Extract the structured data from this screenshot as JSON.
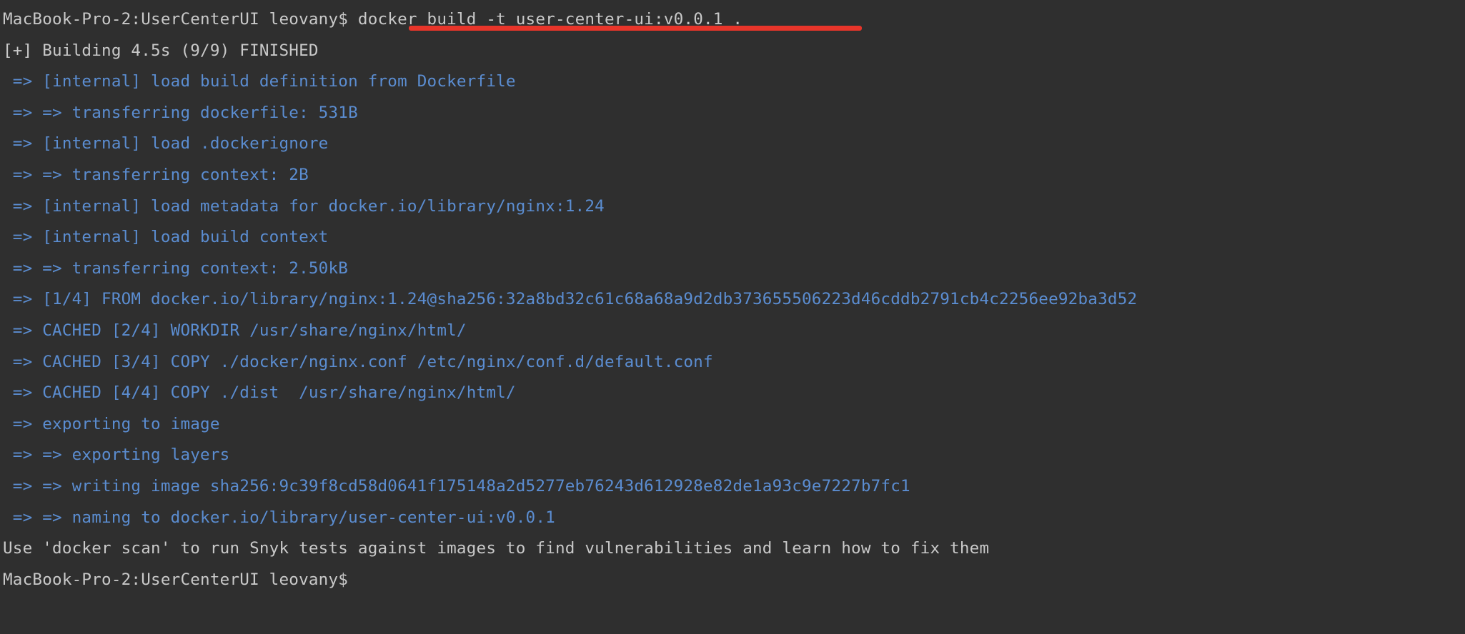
{
  "window": {
    "app": "Terminal",
    "background_color": "#2f2f2f",
    "default_text_color": "#c9c9c9",
    "build_output_color": "#5b8dd1",
    "annotation_color": "#e8352a"
  },
  "session": {
    "prompt": "MacBook-Pro-2:UserCenterUI leovany$",
    "hostname": "MacBook-Pro-2",
    "cwd_name": "UserCenterUI",
    "user": "leovany"
  },
  "command": {
    "prompt": "MacBook-Pro-2:UserCenterUI leovany$ ",
    "text": "docker build -t user-center-ui:v0.0.1 .",
    "image_tag": "user-center-ui:v0.0.1",
    "build_context": "."
  },
  "build": {
    "header": "[+] Building 4.5s (9/9) FINISHED",
    "duration": "4.5s",
    "steps_done": "9",
    "steps_total": "9",
    "status": "FINISHED",
    "lines": [
      " => [internal] load build definition from Dockerfile",
      " => => transferring dockerfile: 531B",
      " => [internal] load .dockerignore",
      " => => transferring context: 2B",
      " => [internal] load metadata for docker.io/library/nginx:1.24",
      " => [internal] load build context",
      " => => transferring context: 2.50kB",
      " => [1/4] FROM docker.io/library/nginx:1.24@sha256:32a8bd32c61c68a68a9d2db373655506223d46cddb2791cb4c2256ee92ba3d52",
      " => CACHED [2/4] WORKDIR /usr/share/nginx/html/",
      " => CACHED [3/4] COPY ./docker/nginx.conf /etc/nginx/conf.d/default.conf",
      " => CACHED [4/4] COPY ./dist  /usr/share/nginx/html/",
      " => exporting to image",
      " => => exporting layers",
      " => => writing image sha256:9c39f8cd58d0641f175148a2d5277eb76243d612928e82de1a93c9e7227b7fc1",
      " => => naming to docker.io/library/user-center-ui:v0.0.1"
    ]
  },
  "footer": {
    "blank": "",
    "hint": "Use 'docker scan' to run Snyk tests against images to find vulnerabilities and learn how to fix them",
    "next_prompt": "MacBook-Pro-2:UserCenterUI leovany$"
  }
}
